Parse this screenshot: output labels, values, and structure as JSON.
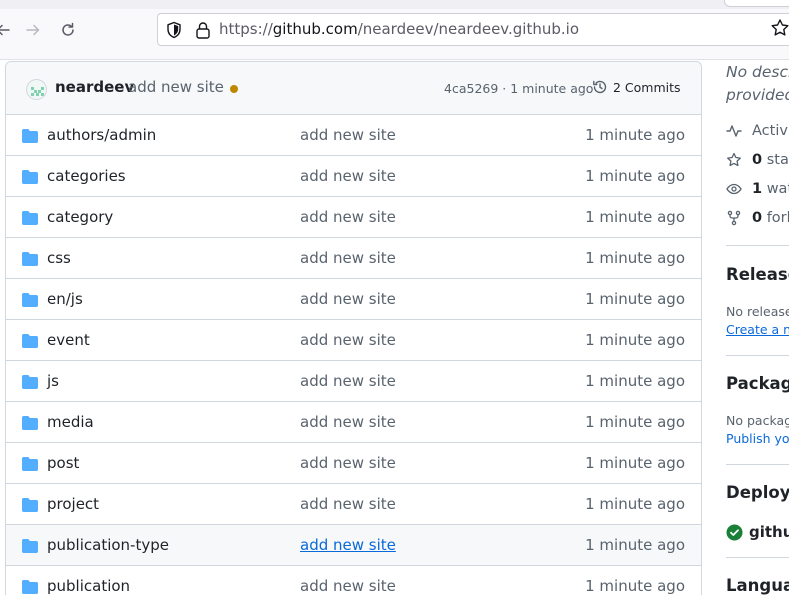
{
  "browser": {
    "url_prefix": "https://",
    "url_domain": "github.com",
    "url_path": "/neardeev/neardeev.github.io"
  },
  "commit": {
    "author": "neardeev",
    "message": "add new site",
    "hash_time": "4ca5269 · 1 minute ago",
    "commits_label": "2 Commits"
  },
  "files": [
    {
      "name": "authors/admin",
      "message": "add new site",
      "time": "1 minute ago"
    },
    {
      "name": "categories",
      "message": "add new site",
      "time": "1 minute ago"
    },
    {
      "name": "category",
      "message": "add new site",
      "time": "1 minute ago"
    },
    {
      "name": "css",
      "message": "add new site",
      "time": "1 minute ago"
    },
    {
      "name": "en/js",
      "message": "add new site",
      "time": "1 minute ago"
    },
    {
      "name": "event",
      "message": "add new site",
      "time": "1 minute ago"
    },
    {
      "name": "js",
      "message": "add new site",
      "time": "1 minute ago"
    },
    {
      "name": "media",
      "message": "add new site",
      "time": "1 minute ago"
    },
    {
      "name": "post",
      "message": "add new site",
      "time": "1 minute ago"
    },
    {
      "name": "project",
      "message": "add new site",
      "time": "1 minute ago"
    },
    {
      "name": "publication-type",
      "message": "add new site",
      "time": "1 minute ago"
    },
    {
      "name": "publication",
      "message": "add new site",
      "time": "1 minute ago"
    }
  ],
  "sidebar": {
    "desc_line1": "No descr",
    "desc_line2": "provided.",
    "activity": "Activi",
    "stars_count": "0",
    "stars_label": "star",
    "watch_count": "1",
    "watch_label": "wat",
    "forks_count": "0",
    "forks_label": "fork",
    "releases_heading": "Releases",
    "releases_none": "No releases",
    "releases_link": "Create a ne",
    "packages_heading": "Package",
    "packages_none": "No package",
    "packages_link": "Publish you",
    "deployments_heading": "Deploym",
    "deployment_env": "github",
    "languages_heading": "Languag"
  },
  "colors": {
    "folder": "#54aeff",
    "link": "#0969da",
    "status_pending": "#bf8700",
    "success": "#1a7f37"
  }
}
